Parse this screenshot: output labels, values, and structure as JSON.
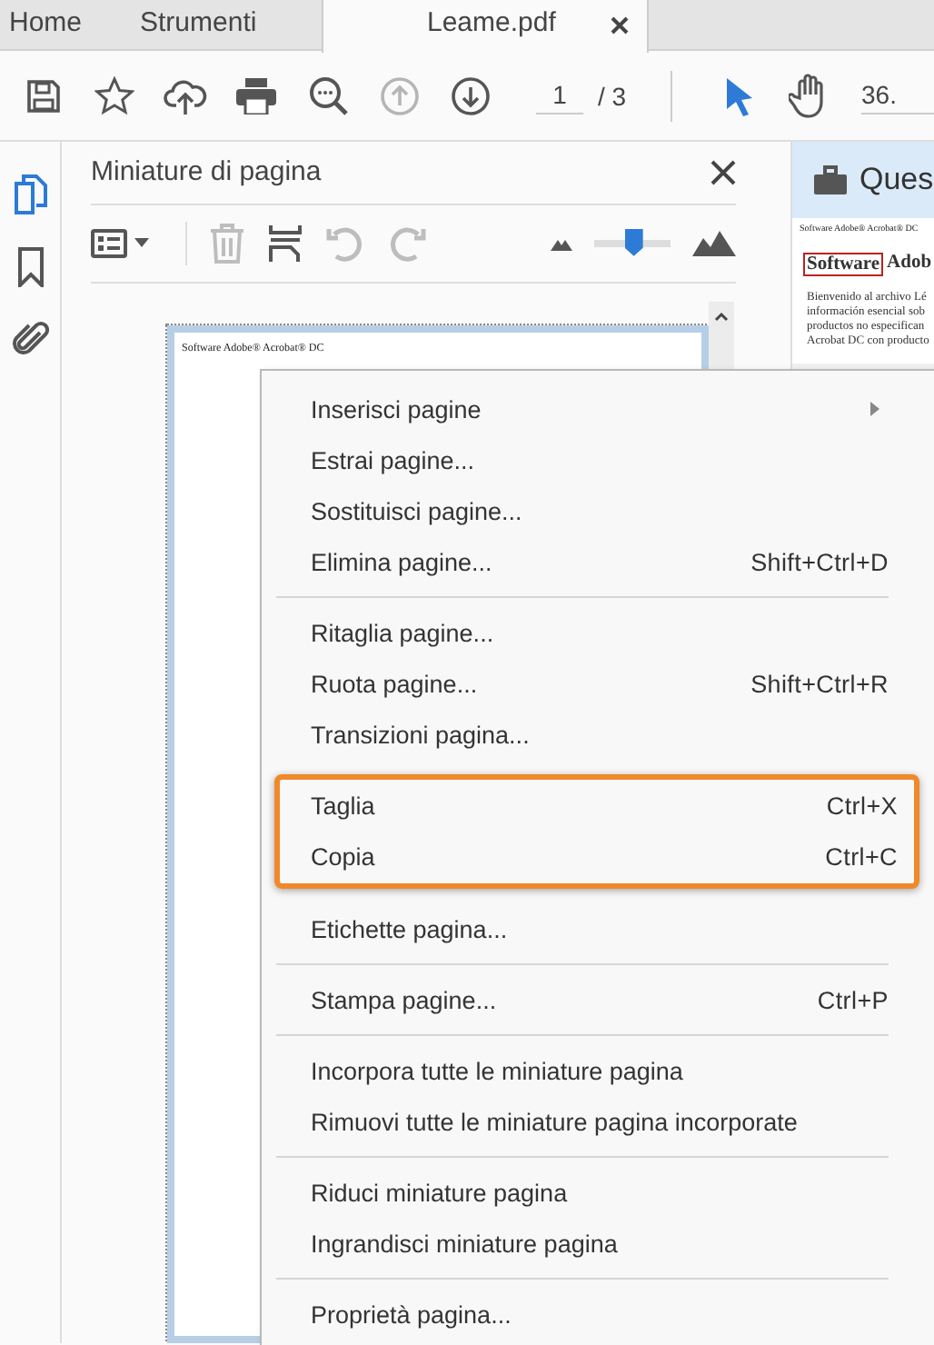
{
  "tabs": [
    {
      "label": "Home",
      "selected": false
    },
    {
      "label": "Strumenti",
      "selected": false
    },
    {
      "label": "Leame.pdf",
      "selected": true
    }
  ],
  "toolbar": {
    "nav_buttons": [
      {
        "disabled": true
      },
      {
        "disabled": false
      }
    ],
    "page_field": {
      "value": "1"
    },
    "page_count": "/ 3",
    "select_tools": [
      {
        "selected": true
      },
      {
        "selected": false
      }
    ],
    "zoom_field": {
      "value": "36."
    }
  },
  "rail": [
    {
      "selected": true
    },
    {
      "selected": false
    },
    {
      "selected": false
    }
  ],
  "panel": {
    "title": "Miniature di pagina",
    "tools": [
      {
        "disabled": false
      },
      {
        "disabled": true
      },
      {
        "disabled": false
      },
      {
        "disabled": true
      },
      {
        "disabled": true
      }
    ],
    "size_slider": {
      "level": 0.52
    },
    "thumbnail": {
      "selected": true,
      "header": "Software Adobe® Acrobat® DC"
    }
  },
  "document": {
    "banner": "Ques",
    "header": "Software Adobe® Acrobat® DC",
    "heading_boxed": "Software",
    "heading_rest": "Adob",
    "paragraph_lines": [
      "Bienvenido al archivo Lé",
      "información esencial sob",
      "productos no especifican",
      "Acrobat DC con producto"
    ]
  },
  "menu": {
    "groups": [
      {
        "highlighted": false,
        "items": [
          {
            "label": "Inserisci pagine",
            "submenu": true
          },
          {
            "label": "Estrai pagine...",
            "submenu": false
          },
          {
            "label": "Sostituisci pagine...",
            "submenu": false
          },
          {
            "label": "Elimina pagine...",
            "submenu": false,
            "shortcut": "Shift+Ctrl+D"
          }
        ]
      },
      {
        "highlighted": false,
        "items": [
          {
            "label": "Ritaglia pagine...",
            "submenu": false
          },
          {
            "label": "Ruota pagine...",
            "submenu": false,
            "shortcut": "Shift+Ctrl+R"
          },
          {
            "label": "Transizioni pagina...",
            "submenu": false
          }
        ]
      },
      {
        "highlighted": true,
        "items": [
          {
            "label": "Taglia",
            "submenu": false,
            "shortcut": "Ctrl+X"
          },
          {
            "label": "Copia",
            "submenu": false,
            "shortcut": "Ctrl+C"
          }
        ]
      },
      {
        "highlighted": false,
        "items": [
          {
            "label": "Etichette pagina...",
            "submenu": false
          }
        ]
      },
      {
        "highlighted": false,
        "items": [
          {
            "label": "Stampa pagine...",
            "submenu": false,
            "shortcut": "Ctrl+P"
          }
        ]
      },
      {
        "highlighted": false,
        "items": [
          {
            "label": "Incorpora tutte le miniature pagina",
            "submenu": false
          },
          {
            "label": "Rimuovi tutte le miniature pagina incorporate",
            "submenu": false
          }
        ]
      },
      {
        "highlighted": false,
        "items": [
          {
            "label": "Riduci miniature pagina",
            "submenu": false
          },
          {
            "label": "Ingrandisci miniature pagina",
            "submenu": false
          }
        ]
      },
      {
        "highlighted": false,
        "items": [
          {
            "label": "Proprietà pagina...",
            "submenu": false
          }
        ]
      }
    ]
  }
}
